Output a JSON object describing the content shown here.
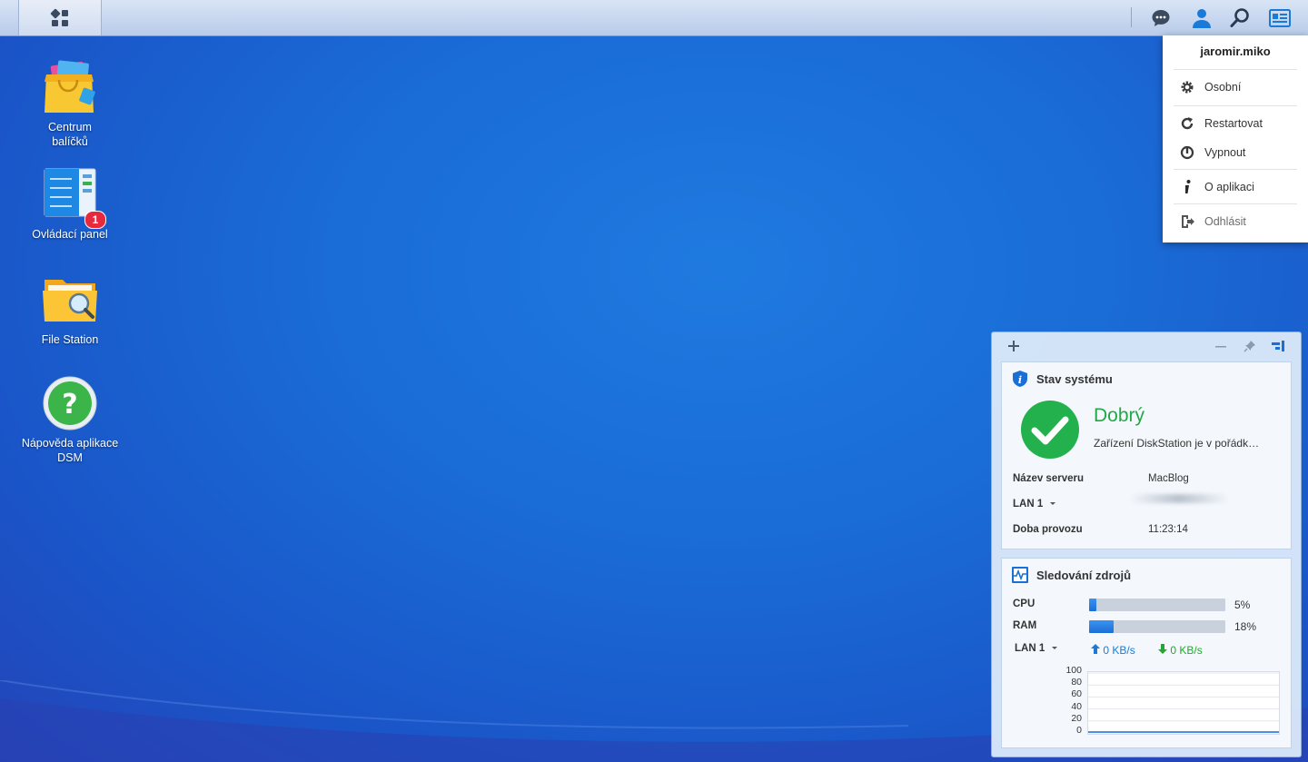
{
  "desktop": {
    "icons": [
      {
        "label": "Centrum\nbalíčků",
        "line1": "Centrum",
        "line2": "balíčků"
      },
      {
        "label": "Ovládací panel",
        "badge": "1"
      },
      {
        "label": "File Station"
      },
      {
        "label": "Nápověda aplikace DSM",
        "line1": "Nápověda aplikace",
        "line2": "DSM"
      }
    ]
  },
  "taskbar": {
    "icons": [
      "main-menu-icon",
      "chat-icon",
      "user-icon",
      "search-icon",
      "widgets-icon"
    ]
  },
  "user_menu": {
    "username": "jaromir.miko",
    "items": [
      {
        "label": "Osobní",
        "icon": "gear-icon"
      },
      {
        "label": "Restartovat",
        "icon": "restart-icon"
      },
      {
        "label": "Vypnout",
        "icon": "power-icon"
      },
      {
        "label": "O aplikaci",
        "icon": "info-icon"
      },
      {
        "label": "Odhlásit",
        "icon": "logout-icon"
      }
    ]
  },
  "system_status": {
    "title": "Stav systému",
    "status": "Dobrý",
    "message": "Zařízení DiskStation je v pořádk…",
    "server_name_label": "Název serveru",
    "server_name": "MacBlog",
    "lan_label": "LAN 1",
    "uptime_label": "Doba provozu",
    "uptime": "11:23:14",
    "status_color": "#22b14c"
  },
  "resource_monitor": {
    "title": "Sledování zdrojů",
    "cpu_label": "CPU",
    "cpu_value": "5%",
    "cpu_fraction": 0.05,
    "ram_label": "RAM",
    "ram_value": "18%",
    "ram_fraction": 0.18,
    "lan_label": "LAN 1",
    "upload": "0 KB/s",
    "download": "0 KB/s",
    "upload_color": "#1a7bd6",
    "download_color": "#22a82e"
  },
  "chart_data": {
    "type": "line",
    "title": "",
    "xlabel": "",
    "ylabel": "",
    "y_ticks": [
      "100",
      "80",
      "60",
      "40",
      "20",
      "0"
    ],
    "ylim": [
      0,
      100
    ],
    "grid": true,
    "series": [
      {
        "values": [
          0,
          0,
          0,
          0,
          0,
          0,
          0,
          0,
          0,
          0
        ]
      }
    ]
  }
}
